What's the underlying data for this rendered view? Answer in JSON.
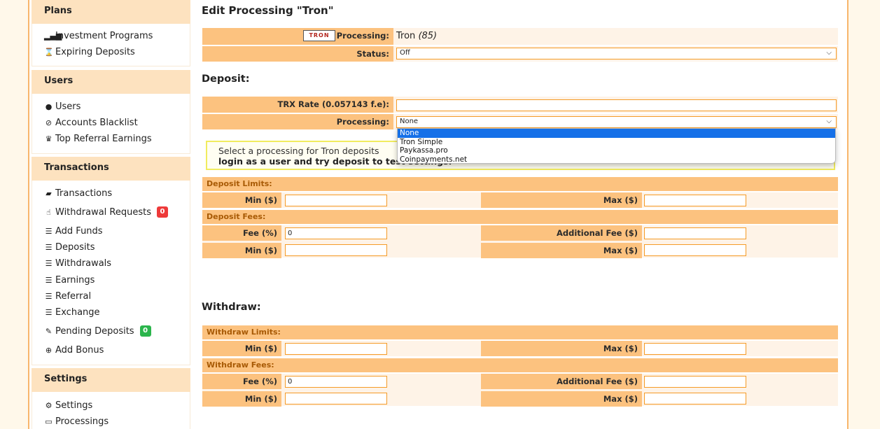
{
  "sidebar": {
    "sections": [
      {
        "title": "Plans",
        "items": [
          {
            "icon": "signal-bars-icon",
            "label": "Investment Programs"
          },
          {
            "icon": "hourglass-icon",
            "label": "Expiring Deposits"
          }
        ]
      },
      {
        "title": "Users",
        "items": [
          {
            "icon": "user-icon",
            "label": "Users"
          },
          {
            "icon": "ban-circle-icon",
            "label": "Accounts Blacklist"
          },
          {
            "icon": "trophy-icon",
            "label": "Top Referral Earnings"
          }
        ]
      },
      {
        "title": "Transactions",
        "items": [
          {
            "icon": "book-icon",
            "label": "Transactions"
          },
          {
            "icon": "hand-icon",
            "label": "Withdrawal Requests",
            "badge": "0"
          },
          {
            "icon": "list-icon",
            "label": "Add Funds"
          },
          {
            "icon": "list-icon",
            "label": "Deposits"
          },
          {
            "icon": "list-icon",
            "label": "Withdrawals"
          },
          {
            "icon": "list-icon",
            "label": "Earnings"
          },
          {
            "icon": "list-icon",
            "label": "Referral"
          },
          {
            "icon": "list-icon",
            "label": "Exchange"
          },
          {
            "icon": "sparkle-icon",
            "label": "Pending Deposits",
            "badge": "0"
          },
          {
            "icon": "plus-circle-icon",
            "label": "Add Bonus"
          }
        ]
      },
      {
        "title": "Settings",
        "items": [
          {
            "icon": "gear-icon",
            "label": "Settings"
          },
          {
            "icon": "credit-card-icon",
            "label": "Processings"
          }
        ]
      }
    ]
  },
  "main": {
    "title": "Edit Processing \"Tron\"",
    "processing_label": "Processing:",
    "logo_text": "TRON",
    "processing_name": "Tron",
    "processing_id": "(85)",
    "status_label": "Status:",
    "status_value": "Off",
    "deposit_heading": "Deposit:",
    "rate_label": "TRX Rate (0.057143 f.e):",
    "rate_value": "",
    "deposit_processing_label": "Processing:",
    "deposit_processing_value": "None",
    "dropdown_options": [
      "None",
      "Tron Simple",
      "Paykassa.pro",
      "Coinpayments.net"
    ],
    "info_line1": "Select a processing for Tron deposits",
    "info_line2": "login as a user and try deposit to test settings.",
    "deposit_limits": {
      "title": "Deposit Limits:",
      "min_label": "Min ($)",
      "min_value": "",
      "max_label": "Max ($)",
      "max_value": ""
    },
    "deposit_fees": {
      "title": "Deposit Fees:",
      "fee_label": "Fee (%)",
      "fee_value": "0",
      "add_fee_label": "Additional Fee ($)",
      "add_fee_value": "",
      "min_label": "Min ($)",
      "min_value": "",
      "max_label": "Max ($)",
      "max_value": ""
    },
    "withdraw_heading": "Withdraw:",
    "withdraw_limits": {
      "title": "Withdraw Limits:",
      "min_label": "Min ($)",
      "min_value": "",
      "max_label": "Max ($)",
      "max_value": ""
    },
    "withdraw_fees": {
      "title": "Withdraw Fees:",
      "fee_label": "Fee (%)",
      "fee_value": "0",
      "add_fee_label": "Additional Fee ($)",
      "add_fee_value": "",
      "min_label": "Min ($)",
      "min_value": "",
      "max_label": "Max ($)",
      "max_value": ""
    }
  }
}
